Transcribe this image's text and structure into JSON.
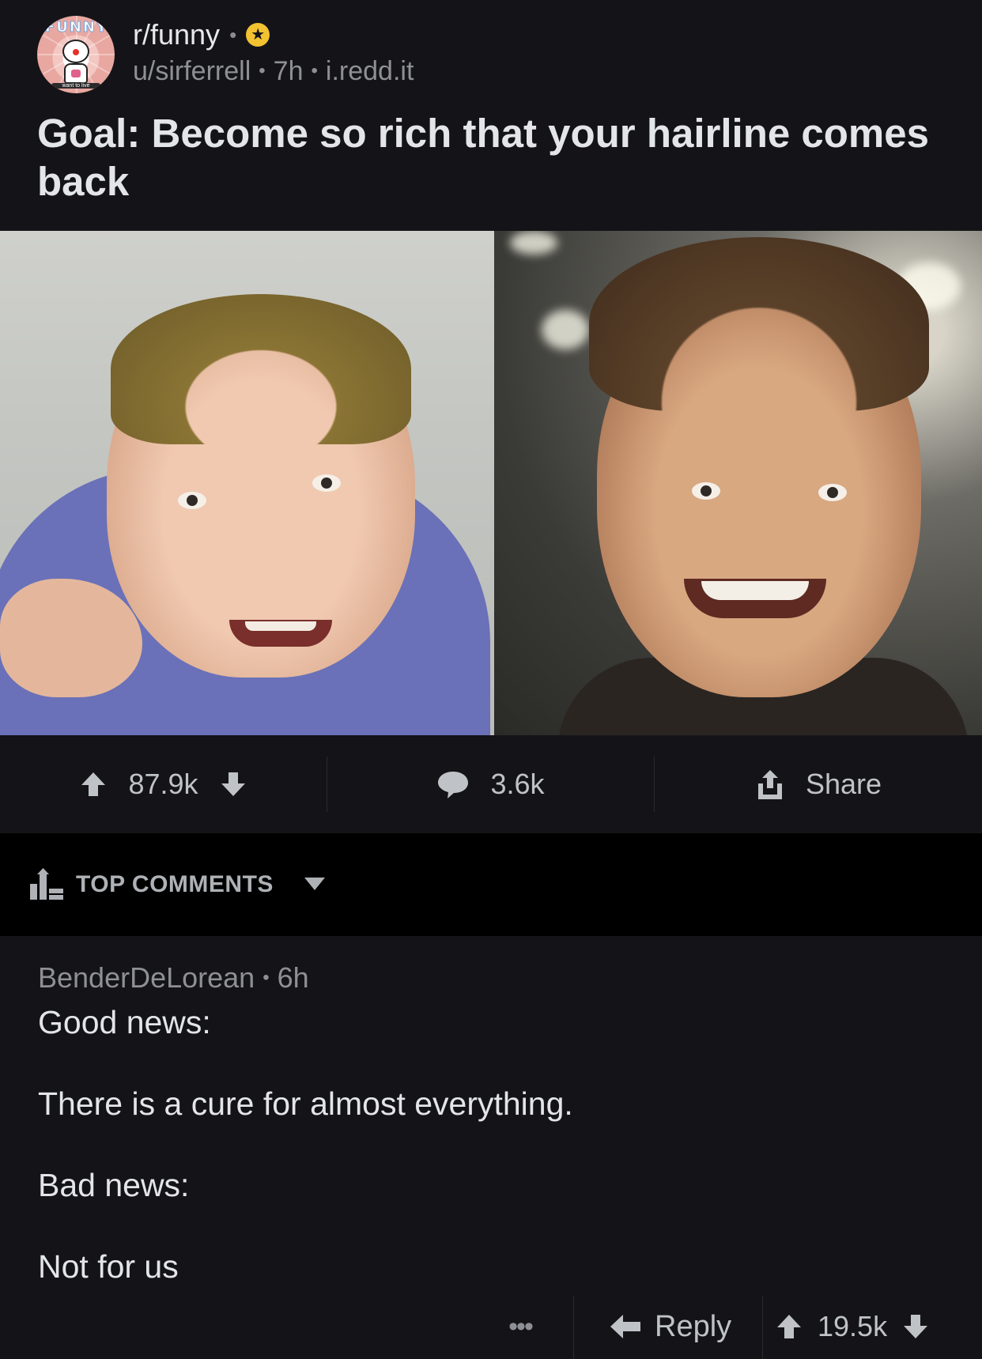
{
  "post": {
    "subreddit": "r/funny",
    "author": "u/sirferrell",
    "age": "7h",
    "domain": "i.redd.it",
    "separator": "•",
    "title": "Goal: Become so rich that your hairline comes back",
    "avatar_banner": "FUNNY",
    "avatar_tagline": "want to live",
    "gold_badge_icon": "star-award-icon"
  },
  "actions": {
    "upvotes": "87.9k",
    "comments": "3.6k",
    "share_label": "Share"
  },
  "sort": {
    "label": "TOP COMMENTS"
  },
  "comment": {
    "author": "BenderDeLorean",
    "age": "6h",
    "separator": "•",
    "lines": [
      "Good news:",
      "There is a cure for almost everything.",
      "Bad news:",
      "Not for us"
    ],
    "more_label": "•••",
    "reply_label": "Reply",
    "score": "19.5k"
  },
  "colors": {
    "background": "#141418",
    "sort_bar": "#000000",
    "gold": "#f2c230",
    "text_primary": "#e3e5e8",
    "text_muted": "#8e9095"
  }
}
